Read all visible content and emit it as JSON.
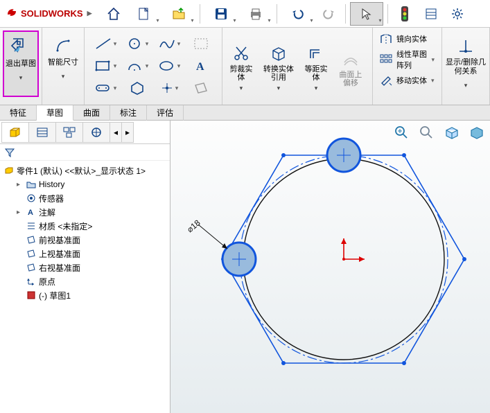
{
  "app": {
    "name": "SOLIDWORKS"
  },
  "ribbon": {
    "exit_sketch": "退出草图",
    "smart_dim": "智能尺寸",
    "trim": "剪裁实体",
    "convert": "转换实体引用",
    "offset": "等距实体",
    "surface_offset": "曲面上偏移",
    "mirror": "镜向实体",
    "linear_pattern": "线性草图阵列",
    "move": "移动实体",
    "display_relations": "显示/删除几何关系"
  },
  "tabs": {
    "items": [
      "特征",
      "草图",
      "曲面",
      "标注",
      "评估"
    ],
    "active": 1
  },
  "tree": {
    "root": "零件1 (默认) <<默认>_显示状态 1>",
    "items": [
      {
        "label": "History"
      },
      {
        "label": "传感器"
      },
      {
        "label": "注解"
      },
      {
        "label": "材质 <未指定>"
      },
      {
        "label": "前视基准面"
      },
      {
        "label": "上视基准面"
      },
      {
        "label": "右视基准面"
      },
      {
        "label": "原点"
      },
      {
        "label": "(-) 草图1"
      }
    ]
  },
  "sketch": {
    "dimension_label": "⌀18"
  }
}
